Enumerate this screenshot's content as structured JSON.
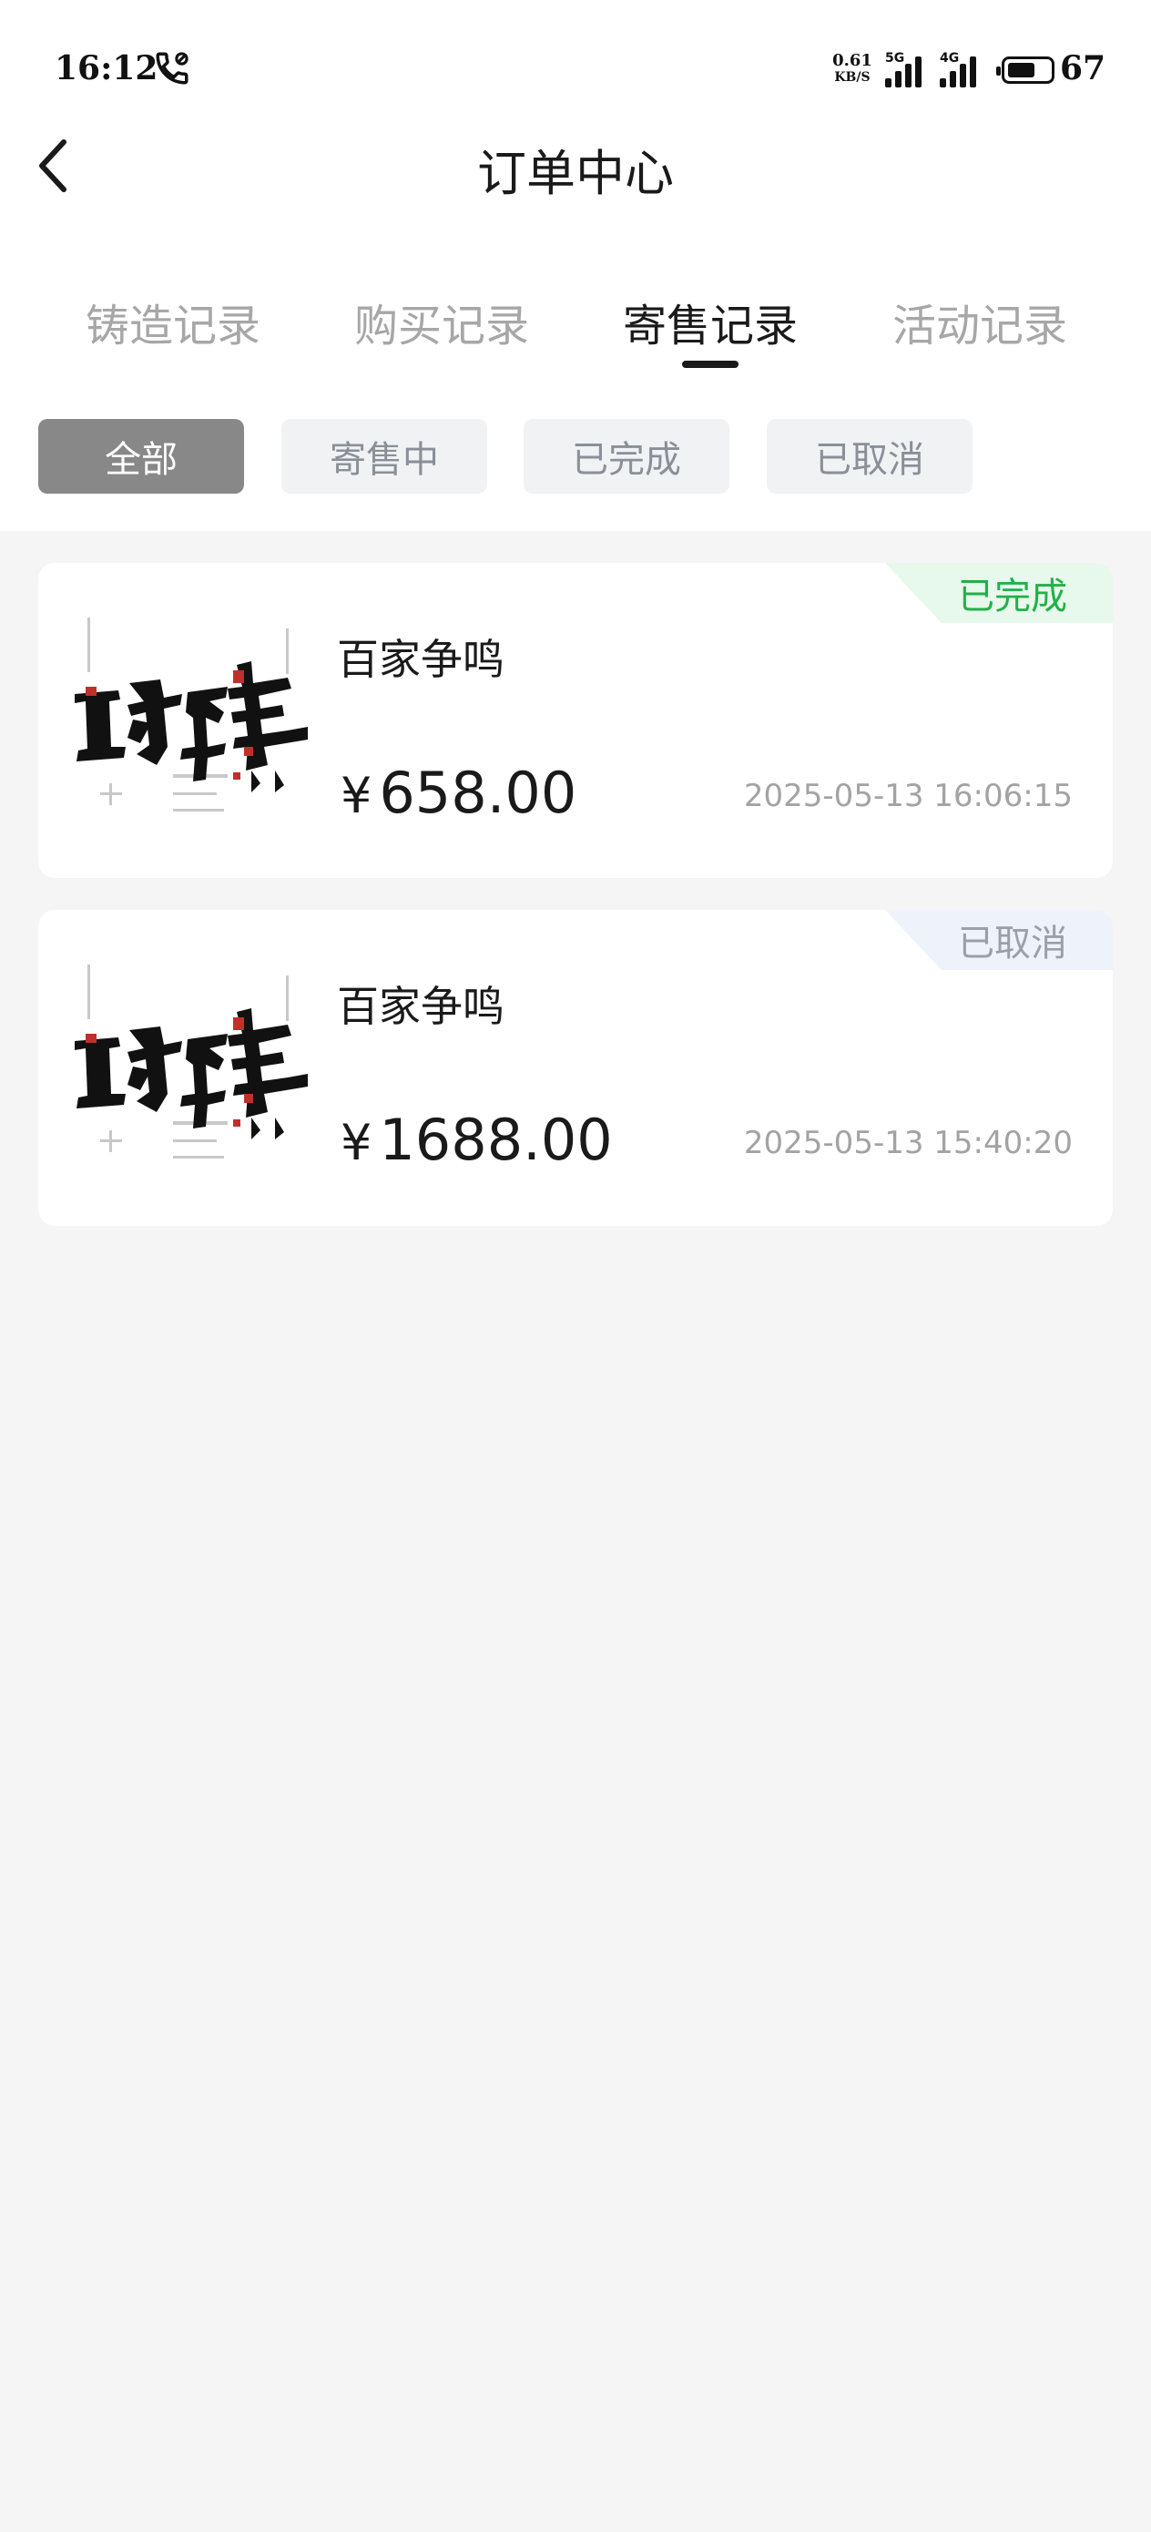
{
  "status_bar": {
    "time": "16:12",
    "net_speed_value": "0.61",
    "net_speed_unit": "KB/S",
    "sim1_tag": "5G",
    "sim2_tag": "4G",
    "battery": "67",
    "battery_level": 0.67
  },
  "header": {
    "title": "订单中心"
  },
  "tabs": [
    {
      "label": "铸造记录",
      "active": false
    },
    {
      "label": "购买记录",
      "active": false
    },
    {
      "label": "寄售记录",
      "active": true
    },
    {
      "label": "活动记录",
      "active": false
    }
  ],
  "filters": [
    {
      "label": "全部",
      "active": true
    },
    {
      "label": "寄售中",
      "active": false
    },
    {
      "label": "已完成",
      "active": false
    },
    {
      "label": "已取消",
      "active": false
    }
  ],
  "orders": [
    {
      "status": "已完成",
      "name": "百家争鸣",
      "currency": "¥",
      "price": "658.00",
      "datetime": "2025-05-13 16:06:15"
    },
    {
      "status": "已取消",
      "name": "百家争鸣",
      "currency": "¥",
      "price": "1688.00",
      "datetime": "2025-05-13 15:40:20"
    }
  ],
  "colors": {
    "completed": "#22b04a",
    "cancelled": "#9aa0aa",
    "active_chip": "#888888"
  }
}
